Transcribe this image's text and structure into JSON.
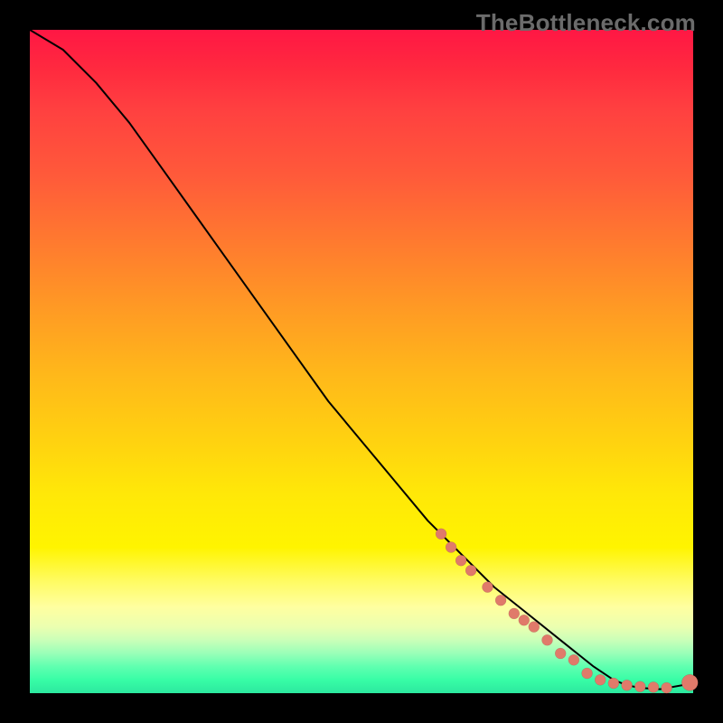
{
  "watermark": "TheBottleneck.com",
  "chart_data": {
    "type": "line",
    "title": "",
    "xlabel": "",
    "ylabel": "",
    "xlim": [
      0,
      100
    ],
    "ylim": [
      0,
      100
    ],
    "grid": false,
    "axes_visible": false,
    "series": [
      {
        "name": "bottleneck-curve",
        "color": "#000000",
        "x": [
          0,
          5,
          10,
          15,
          20,
          25,
          30,
          35,
          40,
          45,
          50,
          55,
          60,
          65,
          70,
          75,
          80,
          85,
          88,
          90,
          92,
          95,
          100
        ],
        "y": [
          100,
          97,
          92,
          86,
          79,
          72,
          65,
          58,
          51,
          44,
          38,
          32,
          26,
          21,
          16,
          12,
          8,
          4,
          2,
          1.2,
          0.8,
          0.6,
          1.5
        ]
      }
    ],
    "points": {
      "name": "sample-dots",
      "color": "#e07a6a",
      "x": [
        62,
        63.5,
        65,
        66.5,
        69,
        71,
        73,
        74.5,
        76,
        78,
        80,
        82,
        84,
        86,
        88,
        90,
        92,
        94,
        96,
        99.5
      ],
      "y": [
        24,
        22,
        20,
        18.5,
        16,
        14,
        12,
        11,
        10,
        8,
        6,
        5,
        3,
        2,
        1.5,
        1.2,
        1.0,
        0.9,
        0.8,
        1.6
      ],
      "r": [
        6,
        6,
        6,
        6,
        6,
        6,
        6,
        6,
        6,
        6,
        6,
        6,
        6,
        6,
        6,
        6,
        6,
        6,
        6,
        9
      ]
    }
  }
}
